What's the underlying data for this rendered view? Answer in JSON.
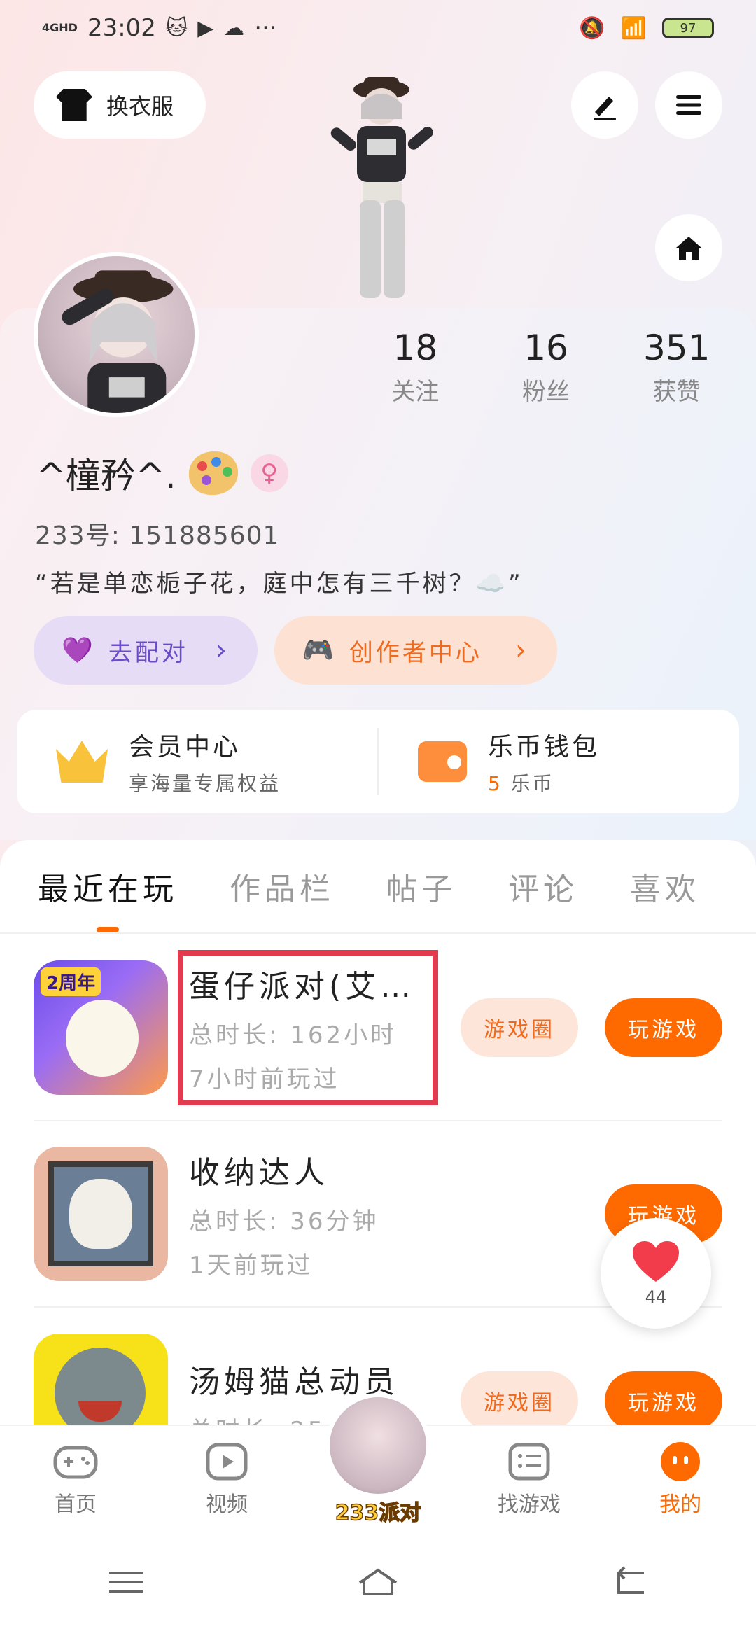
{
  "status_bar": {
    "network": "4GHD",
    "time": "23:02",
    "more": "···",
    "battery": "97"
  },
  "top": {
    "outfit_label": "换衣服"
  },
  "stats": [
    {
      "value": "18",
      "label": "关注"
    },
    {
      "value": "16",
      "label": "粉丝"
    },
    {
      "value": "351",
      "label": "获赞"
    }
  ],
  "profile": {
    "name": "^橦矜^.",
    "uid": "233号: 151885601",
    "bio": "“若是单恋栀子花，庭中怎有三千树？☁️”"
  },
  "pills": {
    "pair_label": "去配对",
    "creator_label": "创作者中心",
    "chevron": "›"
  },
  "member": {
    "vip_title": "会员中心",
    "vip_sub": "享海量专属权益",
    "wallet_title": "乐币钱包",
    "wallet_amount": "5",
    "wallet_unit": "乐币"
  },
  "tabs": [
    "最近在玩",
    "作品栏",
    "帖子",
    "评论",
    "喜欢"
  ],
  "games": [
    {
      "title": "蛋仔派对(艾…",
      "duration": "总时长: 162小时",
      "last": "7小时前玩过",
      "circle_label": "游戏圈",
      "play_label": "玩游戏",
      "badge": "2周年"
    },
    {
      "title": "收纳达人",
      "duration": "总时长: 36分钟",
      "last": "1天前玩过",
      "circle_label": "",
      "play_label": "玩游戏"
    },
    {
      "title": "汤姆猫总动员",
      "duration": "总时长: 25",
      "last": "",
      "circle_label": "游戏圈",
      "play_label": "玩游戏"
    }
  ],
  "like_float": {
    "count": "44"
  },
  "bottom_nav": {
    "home": "首页",
    "video": "视频",
    "center_brand": "233派对",
    "find_game": "找游戏",
    "mine": "我的"
  },
  "colors": {
    "accent": "#ff6a00",
    "highlight": "#e23a4f",
    "pair_purple": "#6a4cc9"
  }
}
